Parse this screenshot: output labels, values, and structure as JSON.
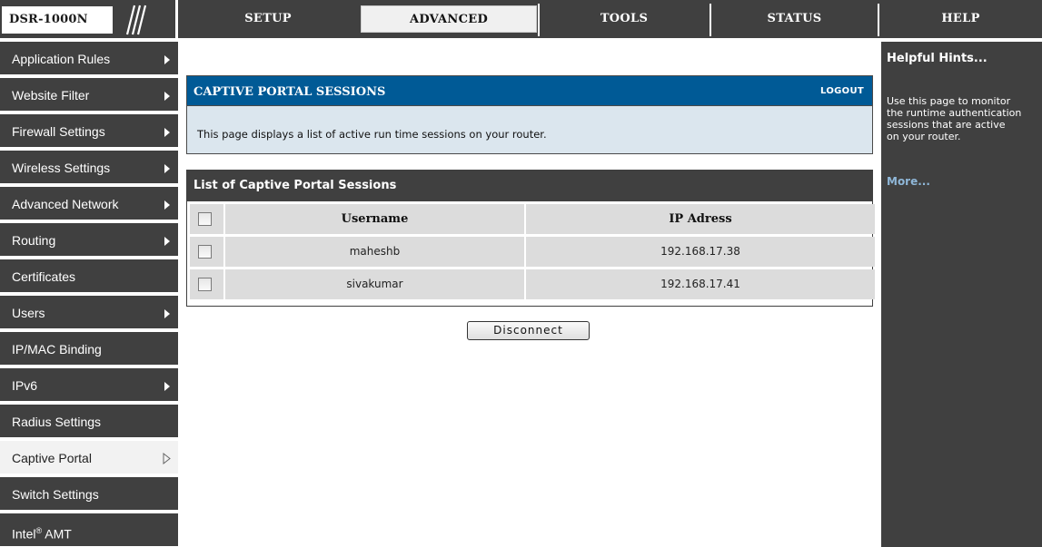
{
  "brand": {
    "model": "DSR-1000N"
  },
  "tabs": [
    {
      "label": "SETUP"
    },
    {
      "label": "ADVANCED"
    },
    {
      "label": "TOOLS"
    },
    {
      "label": "STATUS"
    },
    {
      "label": "HELP"
    }
  ],
  "active_tab": "ADVANCED",
  "sidebar": {
    "items": [
      {
        "label": "Application Rules"
      },
      {
        "label": "Website Filter"
      },
      {
        "label": "Firewall Settings"
      },
      {
        "label": "Wireless Settings"
      },
      {
        "label": "Advanced Network"
      },
      {
        "label": "Routing"
      },
      {
        "label": "Certificates"
      },
      {
        "label": "Users"
      },
      {
        "label": "IP/MAC Binding"
      },
      {
        "label": "IPv6"
      },
      {
        "label": "Radius Settings"
      },
      {
        "label": "Captive Portal"
      },
      {
        "label": "Switch Settings"
      },
      {
        "label": "Intel",
        "sup": "®",
        "suffix": " AMT"
      }
    ],
    "active": "Captive Portal"
  },
  "panel": {
    "title": "CAPTIVE PORTAL SESSIONS",
    "logout": "LOGOUT",
    "description": "This page displays a list of active run time sessions on your router."
  },
  "list": {
    "title": "List of Captive Portal Sessions",
    "columns": [
      "Username",
      "IP Adress"
    ],
    "rows": [
      {
        "username": "maheshb",
        "ip": "192.168.17.38"
      },
      {
        "username": "sivakumar",
        "ip": "192.168.17.41"
      }
    ]
  },
  "actions": {
    "disconnect": "Disconnect"
  },
  "help": {
    "title": "Helpful Hints...",
    "text": "Use this page to monitor\nthe runtime authentication\nsessions that are active\non your router.",
    "more": "More..."
  },
  "colors": {
    "dark_gray": "#404040",
    "header_blue": "#005a96",
    "panel_body": "#dbe6ee",
    "cell_gray": "#dcdcdc",
    "more_link": "#8fb7d8"
  },
  "icons": {
    "submenu": "triangle-right-icon",
    "active_submenu": "triangle-right-outline-icon",
    "checkbox": "checkbox-icon"
  }
}
